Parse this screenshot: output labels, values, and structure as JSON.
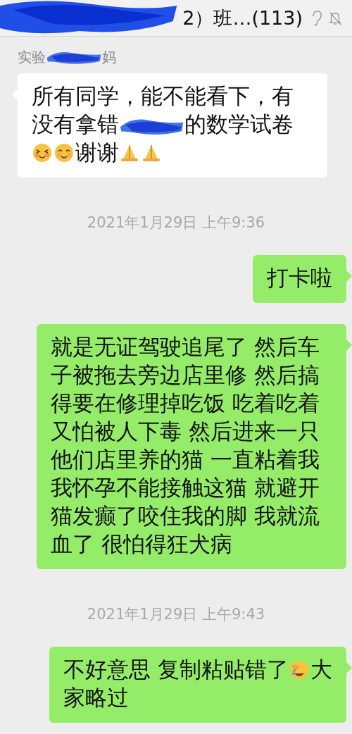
{
  "header": {
    "title": "2）班…(113)",
    "muted": true
  },
  "messages": [
    {
      "kind": "received",
      "sender": [
        {
          "kind": "text",
          "text": "实验"
        },
        {
          "kind": "redacted"
        },
        {
          "kind": "text",
          "text": "妈"
        }
      ],
      "lines": [
        [
          {
            "kind": "text",
            "text": "所有同学，能不能看下，有"
          }
        ],
        [
          {
            "kind": "text",
            "text": "没有拿错"
          },
          {
            "kind": "redacted"
          },
          {
            "kind": "text",
            "text": "的数学试卷"
          }
        ],
        [
          {
            "kind": "blush"
          },
          {
            "kind": "smile"
          },
          {
            "kind": "text",
            "text": "谢谢"
          },
          {
            "kind": "prayer"
          },
          {
            "kind": "prayer"
          }
        ]
      ]
    },
    {
      "kind": "time",
      "text": "2021年1月29日 上午9:36"
    },
    {
      "kind": "sent",
      "lines": [
        [
          {
            "kind": "text",
            "text": "打卡啦"
          }
        ]
      ]
    },
    {
      "kind": "sent",
      "lines": [
        [
          {
            "kind": "text",
            "text": "就是无证驾驶追尾了 然后车子被拖去旁边店里修 然后搞得要在修理掉吃饭 吃着吃着又怕被人下毒 然后进来一只他们店里养的猫 一直粘着我我怀孕不能接触这猫 就避开猫发癫了咬住我的脚 我就流血了 很怕得狂犬病"
          }
        ]
      ]
    },
    {
      "kind": "time",
      "text": "2021年1月29日 上午9:43"
    },
    {
      "kind": "sent",
      "lines": [
        [
          {
            "kind": "text",
            "text": "不好意思 复制粘贴错了"
          },
          {
            "kind": "facepalm"
          },
          {
            "kind": "text",
            "text": "大"
          }
        ],
        [
          {
            "kind": "text",
            "text": "家略过"
          }
        ]
      ]
    }
  ]
}
